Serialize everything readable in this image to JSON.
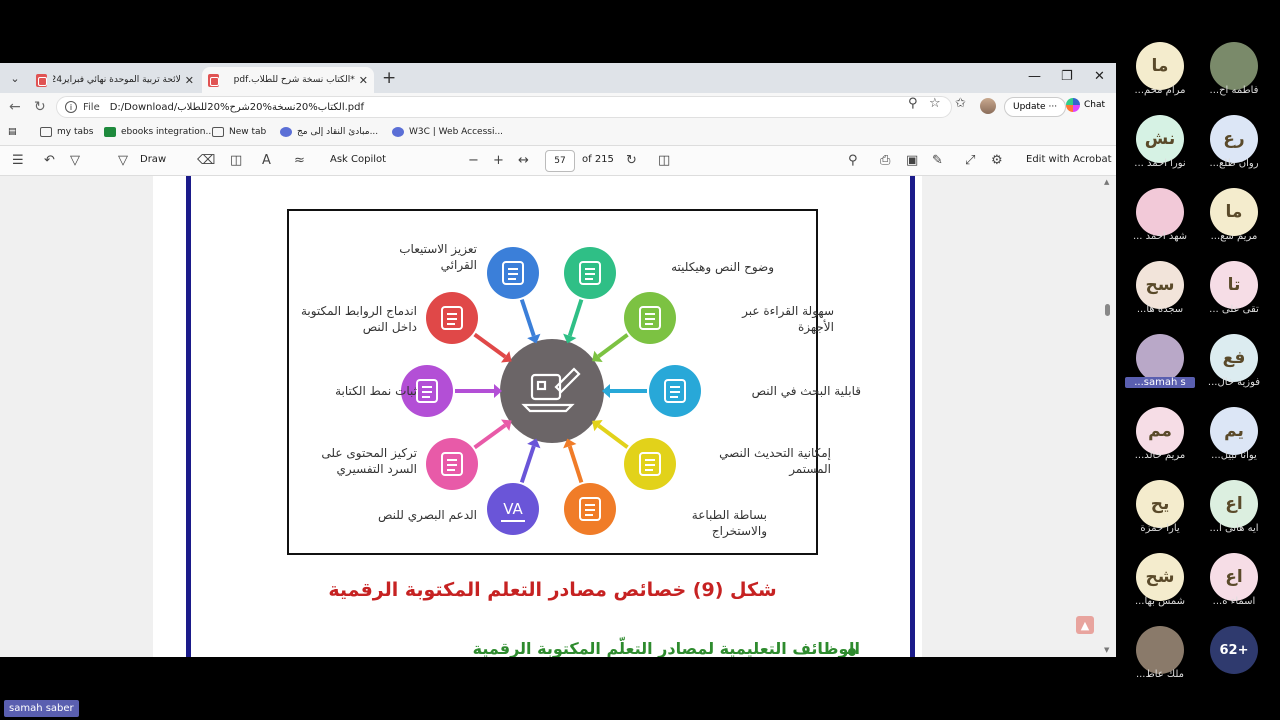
{
  "browser": {
    "tabs": [
      {
        "title": "لائحة تربية الموحدة نهائي فبراير2024",
        "active": false
      },
      {
        "title": "*الكتاب نسخة شرح للطلاب.pdf",
        "active": true
      }
    ],
    "address": {
      "scheme": "File",
      "url": "D:/Download/الكتاب%20نسخة%20شرح%20للطلاب.pdf"
    },
    "update_label": "Update",
    "chat_label": "Chat",
    "bookmarks": [
      "my tabs",
      "ebooks integration...",
      "New tab",
      "مبادئ النقاد إلى مج...",
      "W3C | Web Accessi..."
    ]
  },
  "pdf_toolbar": {
    "draw_label": "Draw",
    "ask_copilot": "Ask Copilot",
    "page_current": "57",
    "page_total": "of 215",
    "edit_acrobat": "Edit with Acrobat"
  },
  "figure": {
    "items": [
      {
        "label_lines": [
          "تعزيز الاستيعاب",
          "القرائي"
        ],
        "color": "#3b7fd9"
      },
      {
        "label_lines": [
          "وضوح النص وهيكليته"
        ],
        "color": "#2fbf86"
      },
      {
        "label_lines": [
          "اندماج الروابط المكتوبة",
          "داخل النص"
        ],
        "color": "#e04848"
      },
      {
        "label_lines": [
          "سهولة القراءة عبر",
          "الأجهزة"
        ],
        "color": "#7cc242"
      },
      {
        "label_lines": [
          "ثبات نمط الكتابة"
        ],
        "color": "#b34fd6"
      },
      {
        "label_lines": [
          "قابلية البحث في النص"
        ],
        "color": "#28a8d8"
      },
      {
        "label_lines": [
          "تركيز المحتوى على",
          "السرد التفسيري"
        ],
        "color": "#e85aa8"
      },
      {
        "label_lines": [
          "إمكانية التحديث النصي",
          "المستمر"
        ],
        "color": "#e2d21a"
      },
      {
        "label_lines": [
          "الدعم البصري للنص"
        ],
        "color": "#6a55d8"
      },
      {
        "label_lines": [
          "بساطة الطباعة",
          "والاستخراج"
        ],
        "color": "#f07c28"
      }
    ],
    "center_color": "#6b6567",
    "icon_glyphs": {
      "va": "VA"
    }
  },
  "caption": "شكل (9) خصائص مصادر التعلم المكتوبة الرقمية",
  "subheading": "الوظائف التعليمية لمصادر التعلّم المكتوبة الرقمية",
  "participants": [
    {
      "initials": "ما",
      "name": "مرام محم...",
      "bg": "#f4eccd"
    },
    {
      "initials": "",
      "name": "فاطمه اح...",
      "bg": "#7a8a6a"
    },
    {
      "initials": "نش",
      "name": "نورا احمد ...",
      "bg": "#d6f2e4"
    },
    {
      "initials": "رع",
      "name": "روان طلع...",
      "bg": "#dce6f6"
    },
    {
      "initials": "",
      "name": "شهد احمد ...",
      "bg": "#f2c9d8"
    },
    {
      "initials": "ما",
      "name": "مريم سع...",
      "bg": "#f4eccd"
    },
    {
      "initials": "سح",
      "name": "سجده ها...",
      "bg": "#f2e4da"
    },
    {
      "initials": "تا",
      "name": "تقى على ...",
      "bg": "#f6dde6"
    },
    {
      "initials": "",
      "name": "samah s...",
      "bg": "#b9a8c8",
      "highlight": true
    },
    {
      "initials": "فع",
      "name": "فوزية خال...",
      "bg": "#dcecf0"
    },
    {
      "initials": "مم",
      "name": "مريم خالد...",
      "bg": "#f6dde6"
    },
    {
      "initials": "يم",
      "name": "يوانا نبيل...",
      "bg": "#dce6f6"
    },
    {
      "initials": "يح",
      "name": "يارا حمزة",
      "bg": "#f4eccd"
    },
    {
      "initials": "اع",
      "name": "ايه هانى ا...",
      "bg": "#dcefe0"
    },
    {
      "initials": "شح",
      "name": "شمس بها...",
      "bg": "#f4eccd"
    },
    {
      "initials": "اع",
      "name": "اسماء ه...",
      "bg": "#f6dde6"
    },
    {
      "initials": "",
      "name": "ملك عاط...",
      "bg": "#8a7a6a"
    },
    {
      "initials": "+62",
      "name": "",
      "bg": "#2f3a6e"
    }
  ],
  "self_name": "samah saber"
}
